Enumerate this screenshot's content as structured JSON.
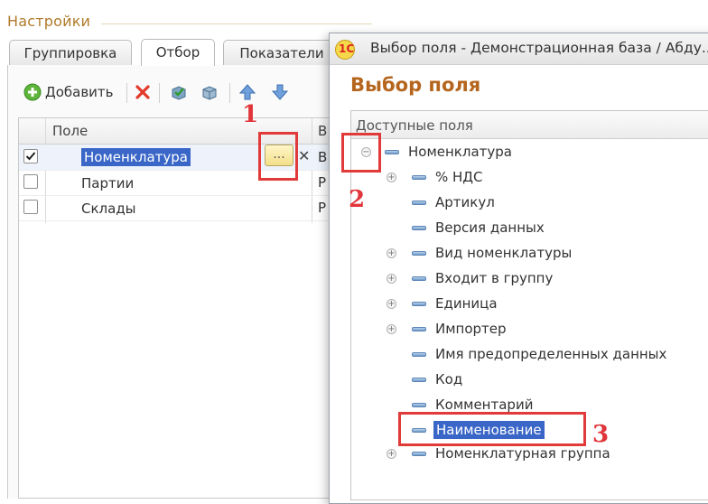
{
  "settings": {
    "title": "Настройки",
    "tabs": [
      {
        "label": "Группировка"
      },
      {
        "label": "Отбор"
      },
      {
        "label": "Показатели"
      }
    ],
    "toolbar": {
      "add_label": "Добавить",
      "icons": [
        "add-icon",
        "delete-icon",
        "check-all-icon",
        "uncheck-all-icon",
        "move-up-icon",
        "move-down-icon"
      ]
    },
    "grid": {
      "columns": [
        "Поле",
        "В"
      ],
      "rows": [
        {
          "checked": true,
          "field": "Номенклатура",
          "v": "В"
        },
        {
          "checked": false,
          "field": "Партии",
          "v": "Р"
        },
        {
          "checked": false,
          "field": "Склады",
          "v": "Р"
        }
      ],
      "dots_label": "...",
      "clear_label": "✕"
    }
  },
  "annotations": [
    "1",
    "2",
    "3"
  ],
  "dialog": {
    "title": "Выбор поля - Демонстрационная база / Абду...",
    "heading": "Выбор поля",
    "tree_header": "Доступные поля",
    "tree": [
      {
        "label": "Номенклатура",
        "expander": "collapse",
        "level": 0
      },
      {
        "label": "% НДС",
        "expander": "expand",
        "level": 1
      },
      {
        "label": "Артикул",
        "expander": "",
        "level": 1
      },
      {
        "label": "Версия данных",
        "expander": "",
        "level": 1
      },
      {
        "label": "Вид номенклатуры",
        "expander": "expand",
        "level": 1
      },
      {
        "label": "Входит в группу",
        "expander": "expand",
        "level": 1
      },
      {
        "label": "Единица",
        "expander": "expand",
        "level": 1
      },
      {
        "label": "Импортер",
        "expander": "expand",
        "level": 1
      },
      {
        "label": "Имя предопределенных данных",
        "expander": "",
        "level": 1
      },
      {
        "label": "Код",
        "expander": "",
        "level": 1
      },
      {
        "label": "Комментарий",
        "expander": "",
        "level": 1
      },
      {
        "label": "Наименование",
        "expander": "",
        "level": 1,
        "selected": true
      },
      {
        "label": "Номенклатурная группа",
        "expander": "expand",
        "level": 1
      }
    ]
  },
  "colors": {
    "accent_orange": "#b5651d",
    "selection_blue": "#3a66c8",
    "annotation_red": "#e03a3a"
  }
}
